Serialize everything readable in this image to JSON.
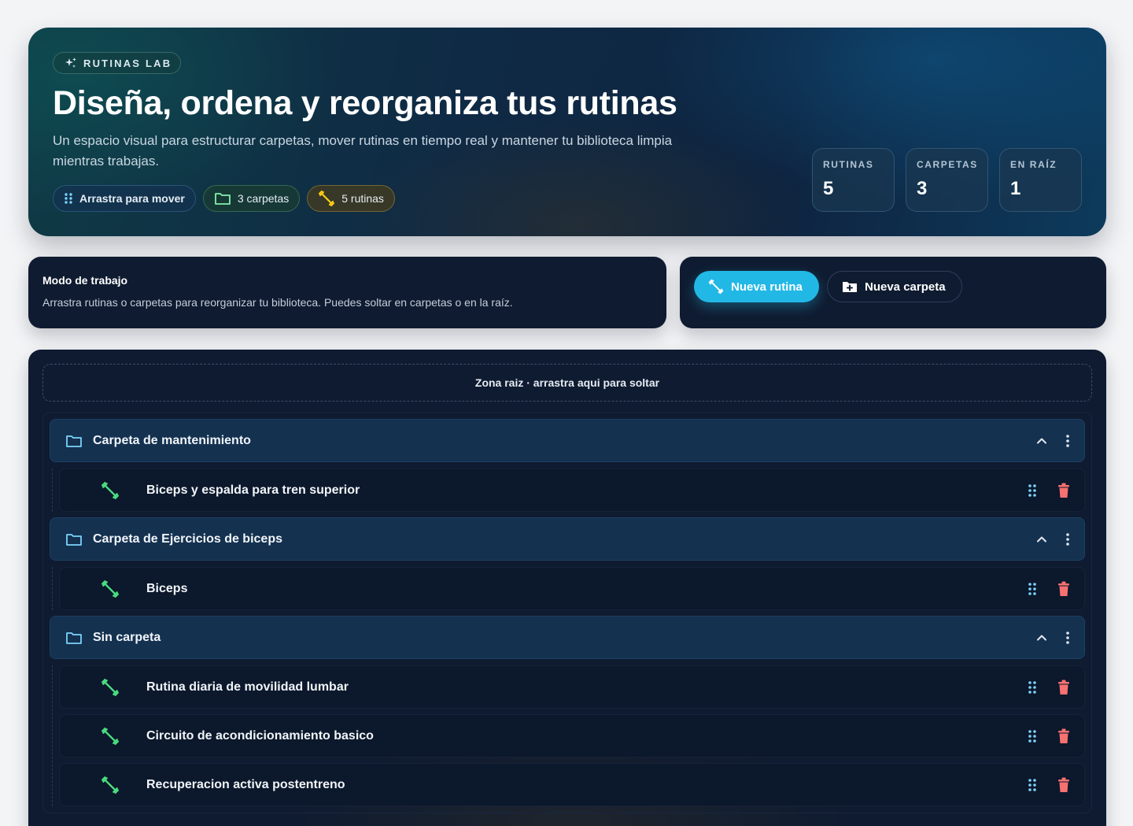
{
  "hero": {
    "badge": "RUTINAS LAB",
    "title": "Diseña, ordena y reorganiza tus rutinas",
    "subtitle": "Un espacio visual para estructurar carpetas, mover rutinas en tiempo real y mantener tu biblioteca limpia mientras trabajas.",
    "chips": {
      "drag": "Arrastra para mover",
      "folders": "3 carpetas",
      "routines": "5 rutinas"
    },
    "stats": [
      {
        "label": "RUTINAS",
        "value": "5"
      },
      {
        "label": "CARPETAS",
        "value": "3"
      },
      {
        "label": "EN RAÍZ",
        "value": "1"
      }
    ]
  },
  "mode": {
    "title": "Modo de trabajo",
    "text": "Arrastra rutinas o carpetas para reorganizar tu biblioteca. Puedes soltar en carpetas o en la raíz."
  },
  "actions": {
    "new_routine": "Nueva rutina",
    "new_folder": "Nueva carpeta"
  },
  "library": {
    "dropzone": "Zona raiz · arrastra aqui para soltar",
    "folders": [
      {
        "name": "Carpeta de mantenimiento",
        "routines": [
          "Biceps y espalda para tren superior"
        ]
      },
      {
        "name": "Carpeta de Ejercicios de biceps",
        "routines": [
          "Biceps"
        ]
      },
      {
        "name": "Sin carpeta",
        "routines": [
          "Rutina diaria de movilidad lumbar",
          "Circuito de acondicionamiento basico",
          "Recuperacion activa postentreno"
        ]
      }
    ]
  },
  "colors": {
    "accent": "#22b8e6",
    "routine_icon": "#4ade80",
    "drag_handle": "#7dd3fc",
    "delete": "#f87171",
    "panel": "#0f1b30"
  }
}
